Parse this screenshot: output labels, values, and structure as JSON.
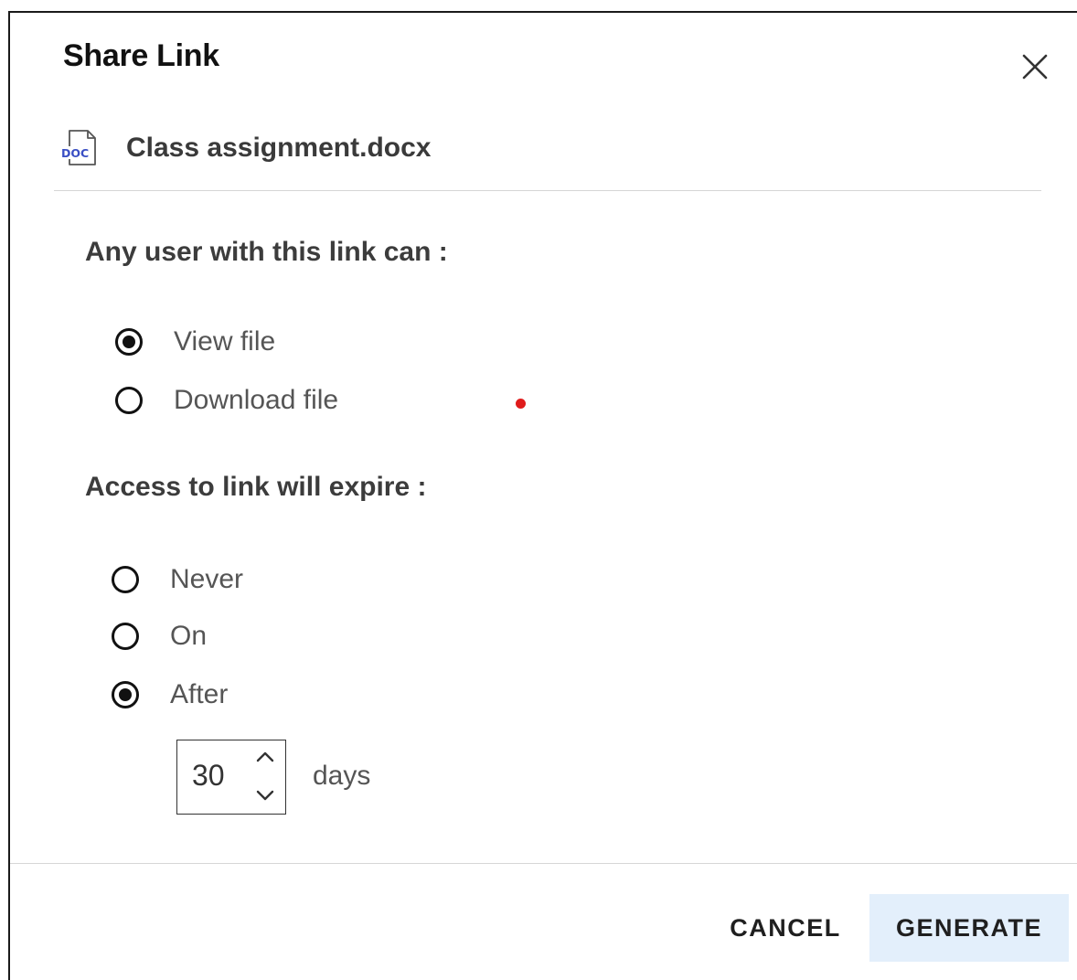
{
  "dialog": {
    "title": "Share Link",
    "close_icon": "close-icon"
  },
  "file": {
    "icon": "doc-file-icon",
    "icon_text": "DOC",
    "name": "Class assignment.docx",
    "icon_color": "#3a4fc4"
  },
  "permissions": {
    "label": "Any user with this link can :",
    "options": [
      {
        "label": "View file",
        "checked": true
      },
      {
        "label": "Download file",
        "checked": false
      }
    ]
  },
  "expiry": {
    "label": "Access to link will expire :",
    "options": [
      {
        "label": "Never",
        "checked": false
      },
      {
        "label": "On",
        "checked": false
      },
      {
        "label": "After",
        "checked": true
      }
    ],
    "days_value": "30",
    "days_unit": "days"
  },
  "actions": {
    "cancel_label": "CANCEL",
    "generate_label": "GENERATE",
    "generate_bg": "#e3effb"
  },
  "colors": {
    "marker_dot": "#e01c1c"
  }
}
